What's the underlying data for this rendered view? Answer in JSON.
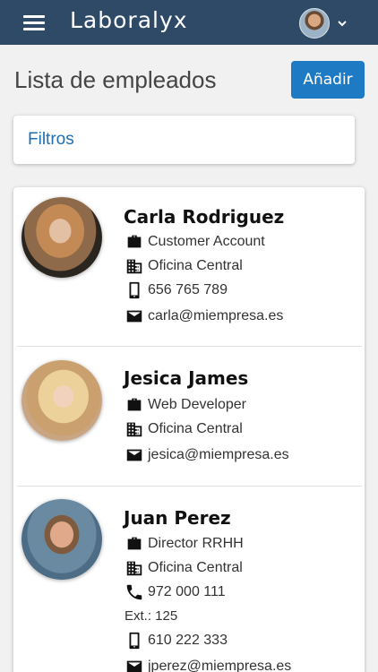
{
  "app": {
    "title": "Laboralyx"
  },
  "header": {
    "menu_icon": "hamburger-menu-icon",
    "user_icon": "user-avatar",
    "dropdown_icon": "chevron-down-icon"
  },
  "page": {
    "title": "Lista de empleados",
    "add_label": "Añadir",
    "filters_label": "Filtros"
  },
  "colors": {
    "topbar": "#2e4a66",
    "accent": "#1f7ac4",
    "link": "#1f6fb2"
  },
  "employees": [
    {
      "name": "Carla Rodriguez",
      "position": "Customer Account",
      "office": "Oficina Central",
      "mobile": "656 765 789",
      "email": "carla@miempresa.es"
    },
    {
      "name": "Jesica James",
      "position": "Web Developer",
      "office": "Oficina Central",
      "email": "jesica@miempresa.es"
    },
    {
      "name": "Juan Perez",
      "position": "Director RRHH",
      "office": "Oficina Central",
      "phone": "972 000 111",
      "ext": "Ext.: 125",
      "mobile": "610 222 333",
      "email": "jperez@miempresa.es"
    }
  ]
}
